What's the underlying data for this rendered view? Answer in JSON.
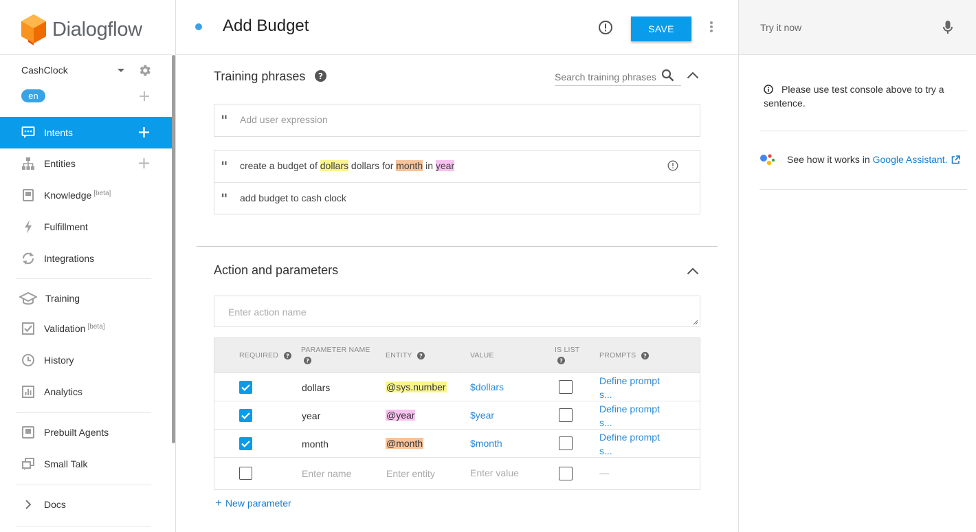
{
  "app": {
    "brand": "Dialogflow"
  },
  "agent": {
    "name": "CashClock",
    "language": "en"
  },
  "sidebar": {
    "items": [
      {
        "label": "Intents",
        "badge": ""
      },
      {
        "label": "Entities",
        "badge": ""
      },
      {
        "label": "Knowledge",
        "badge": "[beta]"
      },
      {
        "label": "Fulfillment",
        "badge": ""
      },
      {
        "label": "Integrations",
        "badge": ""
      },
      {
        "label": "Training",
        "badge": ""
      },
      {
        "label": "Validation",
        "badge": "[beta]"
      },
      {
        "label": "History",
        "badge": ""
      },
      {
        "label": "Analytics",
        "badge": ""
      },
      {
        "label": "Prebuilt Agents",
        "badge": ""
      },
      {
        "label": "Small Talk",
        "badge": ""
      },
      {
        "label": "Docs",
        "badge": ""
      }
    ]
  },
  "header": {
    "title": "Add Budget",
    "save_label": "SAVE"
  },
  "training": {
    "title": "Training phrases",
    "search_placeholder": "Search training phrases",
    "add_placeholder": "Add user expression",
    "phrase1": {
      "t1": "create a budget of ",
      "e1": "dollars",
      "t2": " dollars for ",
      "e2": "month",
      "t3": " in ",
      "e3": "year"
    },
    "phrase2": "add budget to cash clock"
  },
  "actions": {
    "title": "Action and parameters",
    "action_placeholder": "Enter action name",
    "headers": {
      "required": "REQUIRED",
      "parameter_name_1": "PARAMETER NAME",
      "entity": "ENTITY",
      "value": "VALUE",
      "is_list_1": "IS LIST",
      "prompts": "PROMPTS"
    },
    "params": [
      {
        "name": "dollars",
        "entity": "@sys.number",
        "value": "$dollars",
        "prompt_1": "Define prompt",
        "prompt_2": "s..."
      },
      {
        "name": "year",
        "entity": "@year",
        "value": "$year",
        "prompt_1": "Define prompt",
        "prompt_2": "s..."
      },
      {
        "name": "month",
        "entity": "@month",
        "value": "$month",
        "prompt_1": "Define prompt",
        "prompt_2": "s..."
      }
    ],
    "empty_row": {
      "name": "Enter name",
      "entity": "Enter entity",
      "value": "Enter value",
      "prompt": "—"
    },
    "new_parameter": "New parameter"
  },
  "console": {
    "try_placeholder": "Try it now",
    "note": "Please use test console above to try a sentence.",
    "assistant_prefix": "See how it works in",
    "assistant_link": "Google Assistant."
  },
  "colors": {
    "accent": "#0a9bea",
    "entity_yellow": "#f9f58c",
    "entity_orange": "#f7c39a",
    "entity_pink": "#f7c2f0"
  }
}
